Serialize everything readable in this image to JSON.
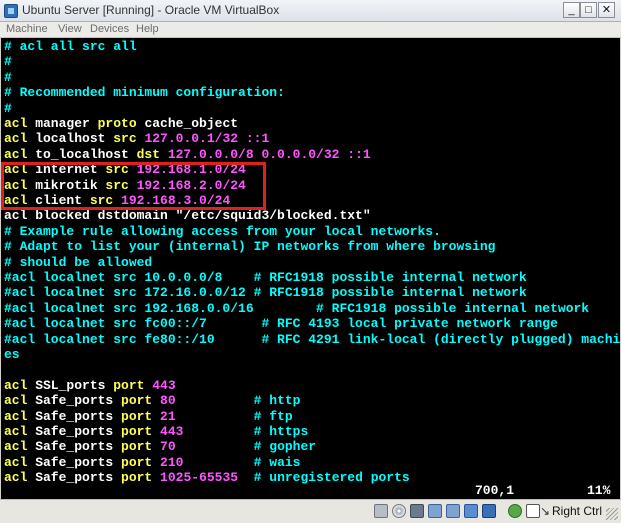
{
  "window": {
    "title": "Ubuntu Server [Running] - Oracle VM VirtualBox",
    "minimize_glyph": "_",
    "maximize_glyph": "□",
    "close_glyph": "✕"
  },
  "menu": [
    "Machine",
    "View",
    "Devices",
    "Help"
  ],
  "terminal": {
    "lines": [
      [
        {
          "t": "# acl all src all",
          "c": "cy"
        }
      ],
      [
        {
          "t": "#",
          "c": "cy"
        }
      ],
      [
        {
          "t": "#",
          "c": "cy"
        }
      ],
      [
        {
          "t": "# Recommended minimum configuration:",
          "c": "cy"
        }
      ],
      [
        {
          "t": "#",
          "c": "cy"
        }
      ],
      [
        {
          "t": "acl",
          "c": "kw"
        },
        {
          "t": " manager ",
          "c": "wh"
        },
        {
          "t": "proto",
          "c": "kw"
        },
        {
          "t": " cache_object",
          "c": "wh"
        }
      ],
      [
        {
          "t": "acl",
          "c": "kw"
        },
        {
          "t": " localhost ",
          "c": "wh"
        },
        {
          "t": "src",
          "c": "kw"
        },
        {
          "t": " 127.0.0.1/32 ::1",
          "c": "mg"
        }
      ],
      [
        {
          "t": "acl",
          "c": "kw"
        },
        {
          "t": " to_localhost ",
          "c": "wh"
        },
        {
          "t": "dst",
          "c": "kw"
        },
        {
          "t": " 127.0.0.0/8 0.0.0.0/32 ::1",
          "c": "mg"
        }
      ],
      [
        {
          "t": "acl",
          "c": "kw"
        },
        {
          "t": " internet ",
          "c": "wh"
        },
        {
          "t": "src",
          "c": "kw"
        },
        {
          "t": " 192.168.1.0/24",
          "c": "mg"
        }
      ],
      [
        {
          "t": "acl",
          "c": "kw"
        },
        {
          "t": " mikrotik ",
          "c": "wh"
        },
        {
          "t": "src",
          "c": "kw"
        },
        {
          "t": " 192.168.2.0/24",
          "c": "mg"
        }
      ],
      [
        {
          "t": "acl",
          "c": "kw"
        },
        {
          "t": " client ",
          "c": "wh"
        },
        {
          "t": "src",
          "c": "kw"
        },
        {
          "t": " 192.168.3.0/24",
          "c": "mg"
        }
      ],
      [
        {
          "t": "acl blocked dstdomain \"/etc/squid3/blocked.txt\"",
          "c": "wh"
        }
      ],
      [
        {
          "t": "# Example rule allowing access from your local networks.",
          "c": "cy"
        }
      ],
      [
        {
          "t": "# Adapt to list your (internal) IP networks from where browsing",
          "c": "cy"
        }
      ],
      [
        {
          "t": "# should be allowed",
          "c": "cy"
        }
      ],
      [
        {
          "t": "#acl localnet src 10.0.0.0/8    # RFC1918 possible internal network",
          "c": "cy"
        }
      ],
      [
        {
          "t": "#acl localnet src 172.16.0.0/12 # RFC1918 possible internal network",
          "c": "cy"
        }
      ],
      [
        {
          "t": "#acl localnet src 192.168.0.0/16        # RFC1918 possible internal network",
          "c": "cy"
        }
      ],
      [
        {
          "t": "#acl localnet src fc00::/7       # RFC 4193 local private network range",
          "c": "cy"
        }
      ],
      [
        {
          "t": "#acl localnet src fe80::/10      # RFC 4291 link-local (directly plugged) machin",
          "c": "cy"
        }
      ],
      [
        {
          "t": "es",
          "c": "cy"
        }
      ],
      [
        {
          "t": "",
          "c": "cy"
        }
      ],
      [
        {
          "t": "acl",
          "c": "kw"
        },
        {
          "t": " SSL_ports ",
          "c": "wh"
        },
        {
          "t": "port",
          "c": "kw"
        },
        {
          "t": " 443",
          "c": "mg"
        }
      ],
      [
        {
          "t": "acl",
          "c": "kw"
        },
        {
          "t": " Safe_ports ",
          "c": "wh"
        },
        {
          "t": "port",
          "c": "kw"
        },
        {
          "t": " 80",
          "c": "mg"
        },
        {
          "t": "          # http",
          "c": "cy"
        }
      ],
      [
        {
          "t": "acl",
          "c": "kw"
        },
        {
          "t": " Safe_ports ",
          "c": "wh"
        },
        {
          "t": "port",
          "c": "kw"
        },
        {
          "t": " 21",
          "c": "mg"
        },
        {
          "t": "          # ftp",
          "c": "cy"
        }
      ],
      [
        {
          "t": "acl",
          "c": "kw"
        },
        {
          "t": " Safe_ports ",
          "c": "wh"
        },
        {
          "t": "port",
          "c": "kw"
        },
        {
          "t": " 443",
          "c": "mg"
        },
        {
          "t": "         # https",
          "c": "cy"
        }
      ],
      [
        {
          "t": "acl",
          "c": "kw"
        },
        {
          "t": " Safe_ports ",
          "c": "wh"
        },
        {
          "t": "port",
          "c": "kw"
        },
        {
          "t": " 70",
          "c": "mg"
        },
        {
          "t": "          # gopher",
          "c": "cy"
        }
      ],
      [
        {
          "t": "acl",
          "c": "kw"
        },
        {
          "t": " Safe_ports ",
          "c": "wh"
        },
        {
          "t": "port",
          "c": "kw"
        },
        {
          "t": " 210",
          "c": "mg"
        },
        {
          "t": "         # wais",
          "c": "cy"
        }
      ],
      [
        {
          "t": "acl",
          "c": "kw"
        },
        {
          "t": " Safe_ports ",
          "c": "wh"
        },
        {
          "t": "port",
          "c": "kw"
        },
        {
          "t": " 1025-65535",
          "c": "mg"
        },
        {
          "t": "  # unregistered ports",
          "c": "cy"
        }
      ]
    ],
    "cursor_position": "700,1",
    "scroll_percent": "11%"
  },
  "colors": {
    "comment": "#00ffff",
    "keyword": "#ffff55",
    "identifier": "#ffffff",
    "value": "#ff55ff",
    "highlight_box": "#e02020"
  },
  "statusbar": {
    "icons": [
      "hard-disk-icon",
      "optical-drive-icon",
      "usb-icon",
      "network-icon",
      "network-icon",
      "shared-folders-icon",
      "display-icon",
      "mouse-capture-icon",
      "mouse-integration-icon"
    ],
    "host_key": "Right Ctrl"
  }
}
